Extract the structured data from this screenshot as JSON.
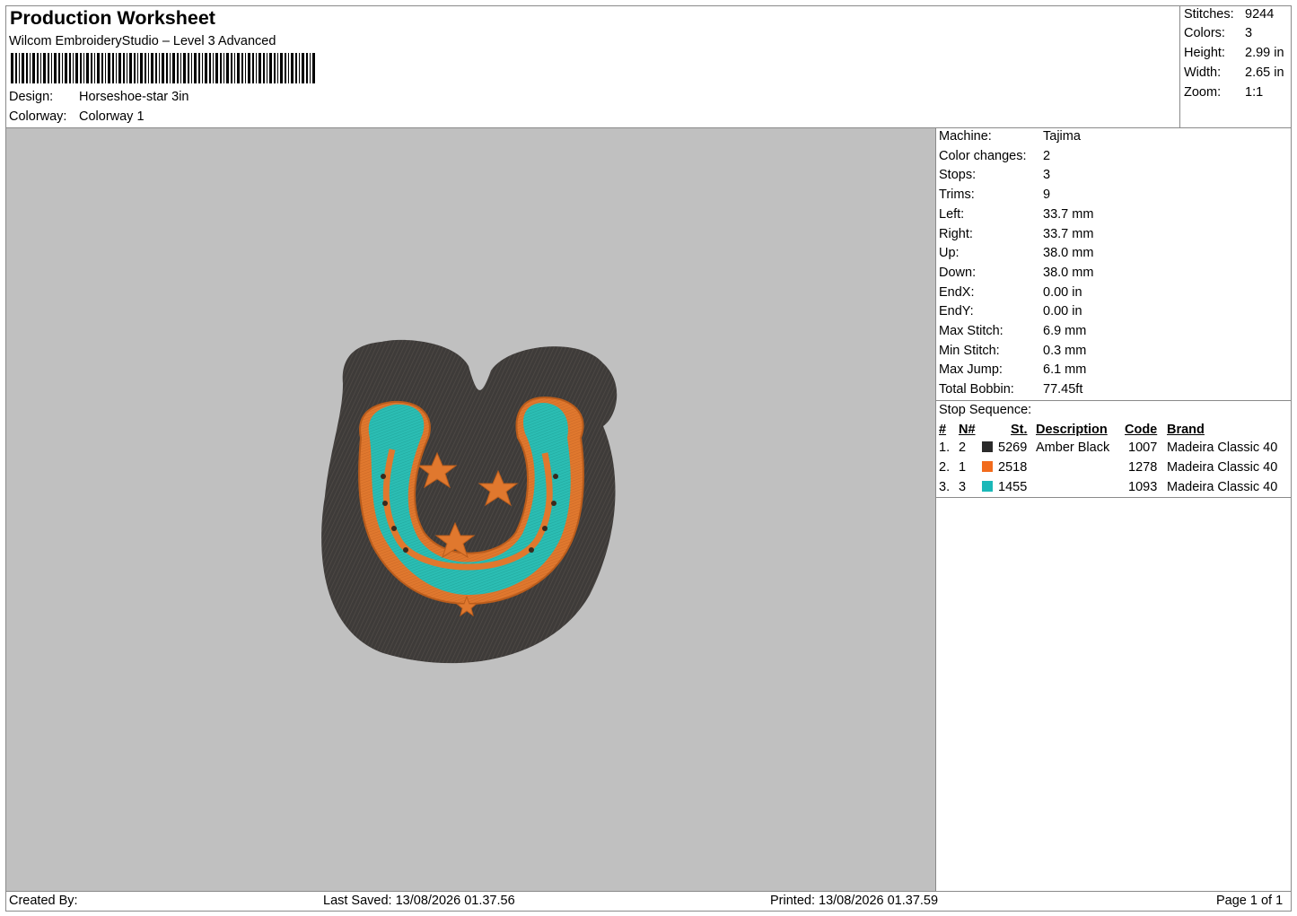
{
  "header": {
    "title": "Production Worksheet",
    "software": "Wilcom EmbroideryStudio – Level 3 Advanced",
    "design_label": "Design:",
    "design_value": "Horseshoe-star 3in",
    "colorway_label": "Colorway:",
    "colorway_value": "Colorway 1"
  },
  "summary": {
    "stitches_label": "Stitches:",
    "stitches_value": "9244",
    "colors_label": "Colors:",
    "colors_value": "3",
    "height_label": "Height:",
    "height_value": "2.99 in",
    "width_label": "Width:",
    "width_value": "2.65 in",
    "zoom_label": "Zoom:",
    "zoom_value": "1:1"
  },
  "machine_info": [
    {
      "label": "Machine:",
      "value": "Tajima"
    },
    {
      "label": "Color changes:",
      "value": "2"
    },
    {
      "label": "Stops:",
      "value": "3"
    },
    {
      "label": "Trims:",
      "value": "9"
    },
    {
      "label": "Left:",
      "value": "33.7 mm"
    },
    {
      "label": "Right:",
      "value": "33.7 mm"
    },
    {
      "label": "Up:",
      "value": "38.0 mm"
    },
    {
      "label": "Down:",
      "value": "38.0 mm"
    },
    {
      "label": "EndX:",
      "value": "0.00 in"
    },
    {
      "label": "EndY:",
      "value": "0.00 in"
    },
    {
      "label": "Max Stitch:",
      "value": "6.9 mm"
    },
    {
      "label": "Min Stitch:",
      "value": "0.3 mm"
    },
    {
      "label": "Max Jump:",
      "value": "6.1 mm"
    },
    {
      "label": "Total Bobbin:",
      "value": "77.45ft"
    }
  ],
  "stop_sequence": {
    "title": "Stop Sequence:",
    "columns": [
      "#",
      "N#",
      "St.",
      "Description",
      "Code",
      "Brand"
    ],
    "rows": [
      {
        "idx": "1.",
        "n": "2",
        "color": "#2b2b2b",
        "st": "5269",
        "desc": "Amber Black",
        "code": "1007",
        "brand": "Madeira Classic 40"
      },
      {
        "idx": "2.",
        "n": "1",
        "color": "#f26b1d",
        "st": "2518",
        "desc": "",
        "code": "1278",
        "brand": "Madeira Classic 40"
      },
      {
        "idx": "3.",
        "n": "3",
        "color": "#1ab8b8",
        "st": "1455",
        "desc": "",
        "code": "1093",
        "brand": "Madeira Classic 40"
      }
    ]
  },
  "footer": {
    "created_by": "Created By:",
    "last_saved": "Last Saved: 13/08/2026 01.37.56",
    "printed": "Printed: 13/08/2026 01.37.59",
    "page": "Page 1 of 1"
  },
  "design_colors": {
    "canvas": "#c0c0c0",
    "backing": "#3e3b39",
    "orange": "#e0782e",
    "teal": "#2bbdb3"
  }
}
